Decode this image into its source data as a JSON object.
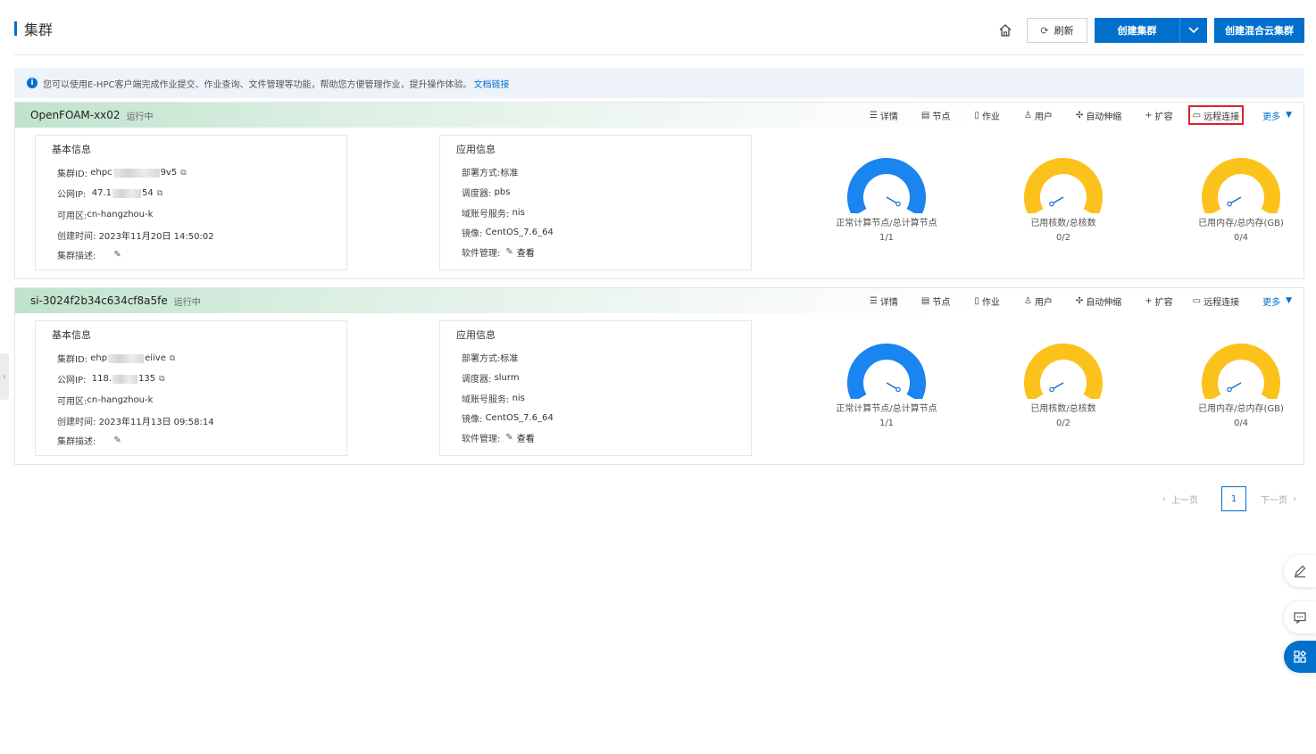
{
  "page": {
    "title": "集群"
  },
  "header": {
    "refresh_label": "刷新",
    "create_label": "创建集群",
    "create_hybrid_label": "创建混合云集群"
  },
  "banner": {
    "text": "您可以使用E-HPC客户端完成作业提交、作业查询、文件管理等功能，帮助您方便管理作业，提升操作体验。",
    "link": "文档链接"
  },
  "actions": {
    "details": "详情",
    "nodes": "节点",
    "jobs": "作业",
    "users": "用户",
    "autoscale": "自动伸缩",
    "expand": "扩容",
    "remote": "远程连接",
    "more": "更多"
  },
  "labels": {
    "basic_info": "基本信息",
    "app_info": "应用信息",
    "cluster_id": "集群ID:",
    "public_ip": "公网IP:",
    "zone": "可用区:",
    "created": "创建时间:",
    "desc": "集群描述:",
    "deploy": "部署方式:",
    "scheduler": "调度器:",
    "domain": "域账号服务:",
    "image": "镜像:",
    "software": "软件管理:",
    "view": "查看"
  },
  "clusters": [
    {
      "name": "OpenFOAM-xx02",
      "status": "运行中",
      "id_prefix": "ehpc",
      "id_suffix": "9v5",
      "ip_prefix": "47.1",
      "ip_suffix": "54",
      "zone": "cn-hangzhou-k",
      "created": "2023年11月20日 14:50:02",
      "deploy": "标准",
      "scheduler": "pbs",
      "domain": "nis",
      "image": "CentOS_7.6_64",
      "gauges": [
        {
          "label": "正常计算节点/总计算节点",
          "value": "1/1",
          "ratio": 1.0,
          "color": "#1a84f0"
        },
        {
          "label": "已用核数/总核数",
          "value": "0/2",
          "ratio": 0.0,
          "color": "#fcc21c"
        },
        {
          "label": "已用内存/总内存(GB)",
          "value": "0/4",
          "ratio": 0.0,
          "color": "#fcc21c"
        }
      ]
    },
    {
      "name": "si-3024f2b34c634cf8a5fe",
      "status": "运行中",
      "id_prefix": "ehp",
      "id_suffix": "eiive",
      "ip_prefix": "118.",
      "ip_suffix": "135",
      "zone": "cn-hangzhou-k",
      "created": "2023年11月13日 09:58:14",
      "deploy": "标准",
      "scheduler": "slurm",
      "domain": "nis",
      "image": "CentOS_7.6_64",
      "gauges": [
        {
          "label": "正常计算节点/总计算节点",
          "value": "1/1",
          "ratio": 1.0,
          "color": "#1a84f0"
        },
        {
          "label": "已用核数/总核数",
          "value": "0/2",
          "ratio": 0.0,
          "color": "#fcc21c"
        },
        {
          "label": "已用内存/总内存(GB)",
          "value": "0/4",
          "ratio": 0.0,
          "color": "#fcc21c"
        }
      ]
    }
  ],
  "pagination": {
    "prev": "上一页",
    "current": "1",
    "next": "下一页"
  }
}
